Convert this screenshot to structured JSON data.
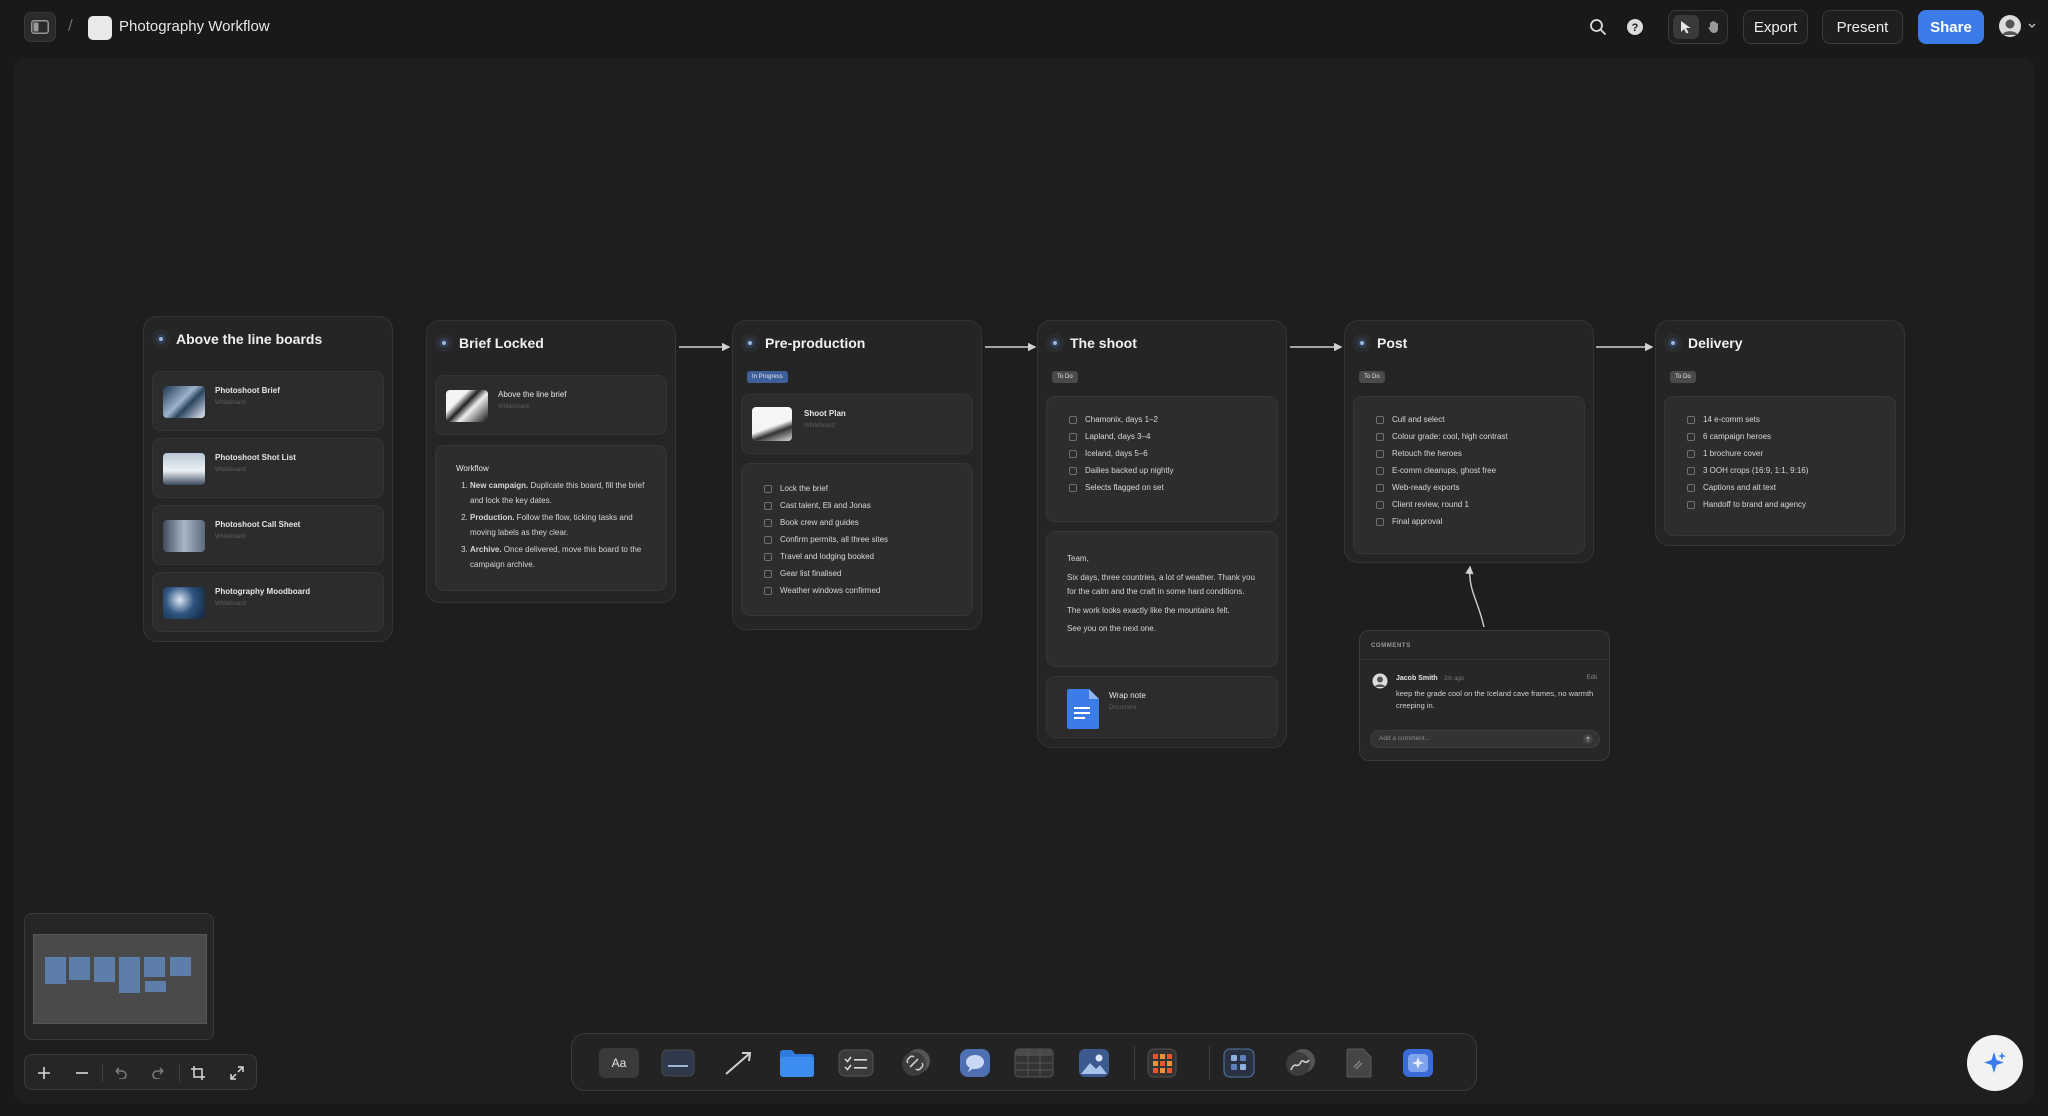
{
  "header": {
    "breadcrumb_sep": "/",
    "title": "Photography Workflow",
    "export_label": "Export",
    "present_label": "Present",
    "share_label": "Share"
  },
  "colors": {
    "accent": "#3b7ce8",
    "in_progress": "#3f5f9a",
    "todo": "#4a4a4a"
  },
  "icons": [
    "sidebar-toggle-icon",
    "doc-icon",
    "search-icon",
    "help-icon",
    "pointer-icon",
    "hand-icon",
    "avatar-icon",
    "chevron-down-icon"
  ],
  "boards": {
    "above": {
      "title": "Above the line boards",
      "items": [
        {
          "title": "Photoshoot Brief",
          "sub": "Whiteboard"
        },
        {
          "title": "Photoshoot Shot List",
          "sub": "Whiteboard"
        },
        {
          "title": "Photoshoot Call Sheet",
          "sub": "Whiteboard"
        },
        {
          "title": "Photography Moodboard",
          "sub": "Whiteboard"
        }
      ]
    },
    "brief": {
      "title": "Brief Locked",
      "link_title": "Above the line brief",
      "link_sub": "Whiteboard",
      "workflow_title": "Workflow",
      "steps": [
        {
          "bold": "New campaign.",
          "text": " Duplicate this board, fill the brief and lock the key dates."
        },
        {
          "bold": "Production.",
          "text": " Follow the flow, ticking tasks and moving labels as they clear."
        },
        {
          "bold": "Archive.",
          "text": " Once delivered, move this board to the campaign archive."
        }
      ]
    },
    "preprod": {
      "title": "Pre-production",
      "status": "In Progress",
      "link_title": "Shoot Plan",
      "link_sub": "Whiteboard",
      "tasks": [
        "Lock the brief",
        "Cast talent, Eli and Jonas",
        "Book crew and guides",
        "Confirm permits, all three sites",
        "Travel and lodging booked",
        "Gear list finalised",
        "Weather windows confirmed"
      ]
    },
    "shoot": {
      "title": "The shoot",
      "status": "To Do",
      "tasks": [
        "Chamonix, days 1–2",
        "Lapland, days 3–4",
        "Iceland, days 5–6",
        "Dailies backed up nightly",
        "Selects flagged on set"
      ],
      "note_lines": [
        "Team,",
        "Six days, three countries, a lot of weather. Thank you for the calm and the craft in some hard conditions.",
        "The work looks exactly like the mountains felt.",
        "See you on the next one."
      ],
      "doc_title": "Wrap note",
      "doc_sub": "Document"
    },
    "post": {
      "title": "Post",
      "status": "To Do",
      "tasks": [
        "Cull and select",
        "Colour grade: cool, high contrast",
        "Retouch the heroes",
        "E-comm cleanups, ghost free",
        "Web-ready exports",
        "Client review, round 1",
        "Final approval"
      ]
    },
    "delivery": {
      "title": "Delivery",
      "status": "To Do",
      "tasks": [
        "14 e-comm sets",
        "6 campaign heroes",
        "1 brochure cover",
        "3 OOH crops (16:9, 1:1, 9:16)",
        "Captions and alt text",
        "Handoff to brand and agency"
      ]
    }
  },
  "comments": {
    "header": "COMMENTS",
    "author": "Jacob Smith",
    "time": "2m ago",
    "edit": "Edit",
    "body": "keep the grade cool on the Iceland cave frames, no warmth creeping in.",
    "placeholder": "Add a comment..."
  },
  "toolbar": {
    "text_tool": "Aa",
    "tools": [
      "text-tool",
      "note-tool",
      "arrow-tool",
      "folder-tool",
      "checklist-tool",
      "link-tool",
      "comment-tool",
      "table-tool",
      "image-tool",
      "apps-tool",
      "board-tool",
      "draw-tool",
      "file-tool",
      "ai-tool"
    ]
  }
}
